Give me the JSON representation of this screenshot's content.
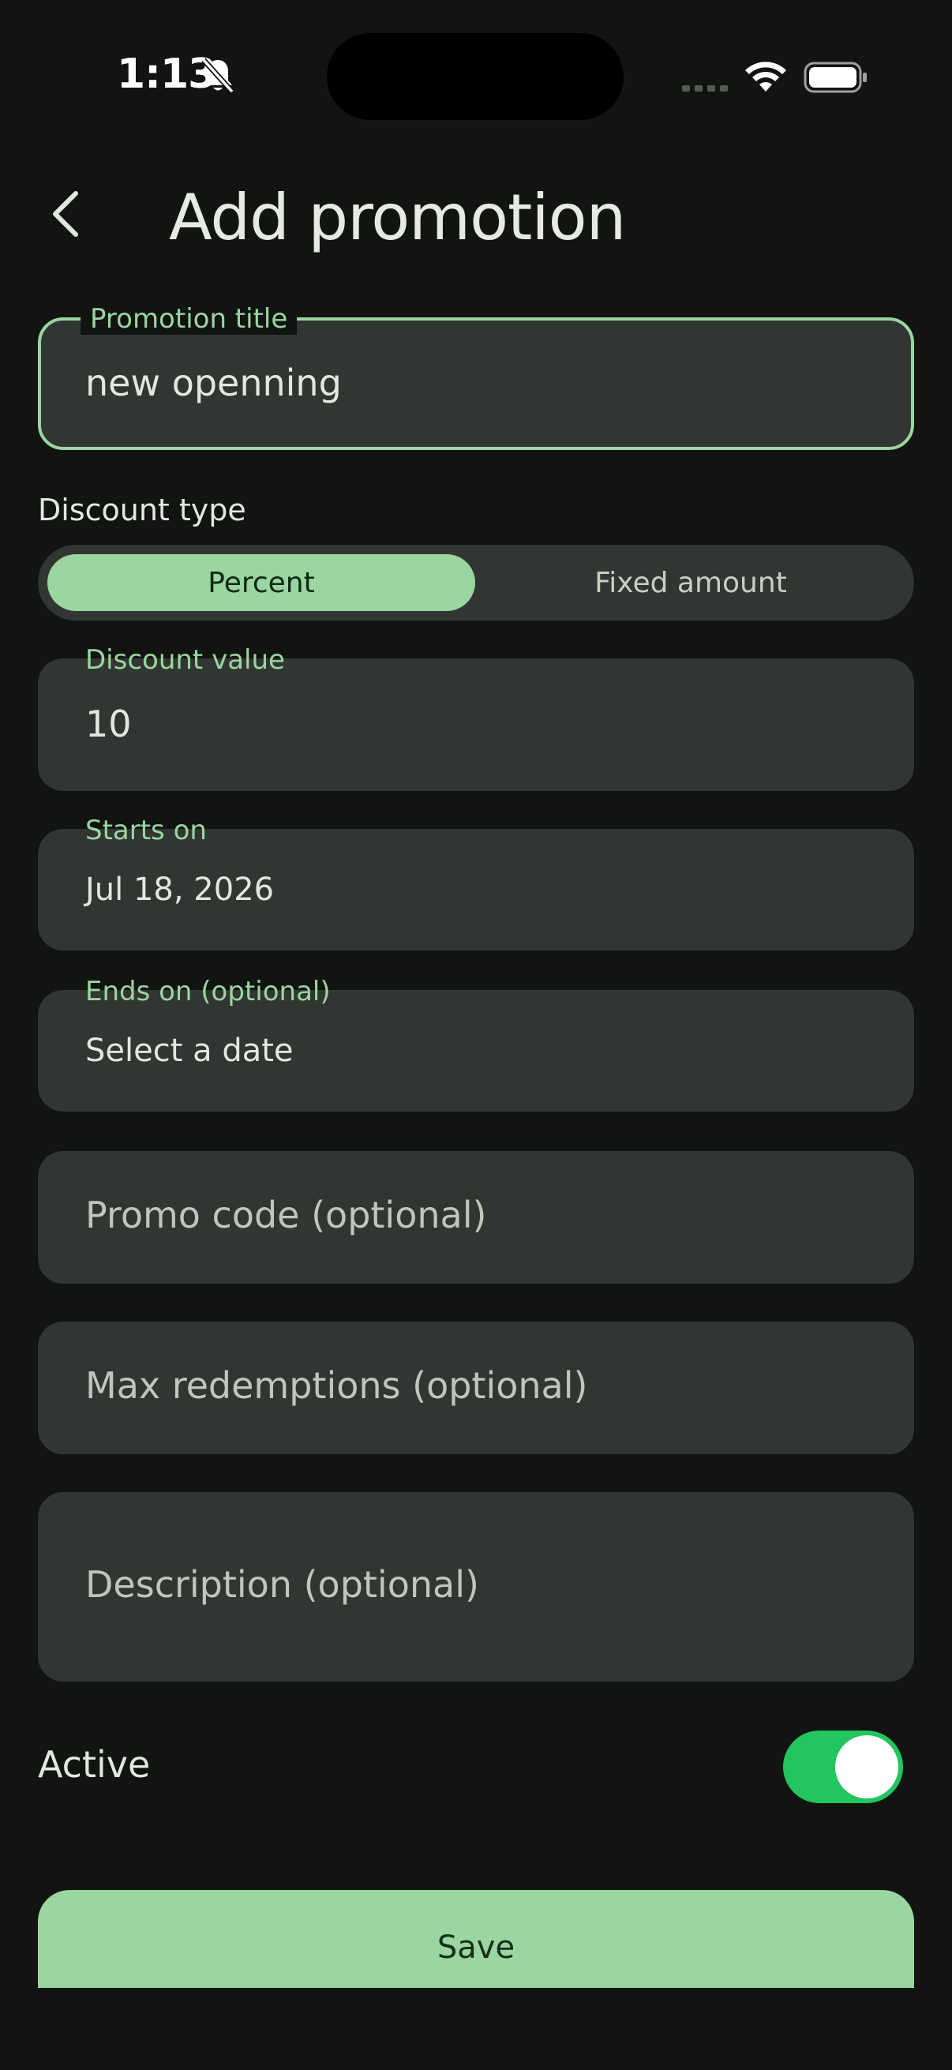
{
  "status_bar": {
    "time": "1:13"
  },
  "header": {
    "title": "Add promotion"
  },
  "form": {
    "promotion_title": {
      "label": "Promotion title",
      "value": "new openning"
    },
    "discount_type": {
      "label": "Discount type",
      "options": [
        "Percent",
        "Fixed amount"
      ],
      "selected": "Percent"
    },
    "discount_value": {
      "label": "Discount value",
      "value": "10"
    },
    "starts_on": {
      "label": "Starts on",
      "value": "Jul 18, 2026"
    },
    "ends_on": {
      "label": "Ends on (optional)",
      "value": "Select a date"
    },
    "promo_code": {
      "placeholder": "Promo code (optional)"
    },
    "max_redemptions": {
      "placeholder": "Max redemptions (optional)"
    },
    "description": {
      "placeholder": "Description (optional)"
    },
    "active": {
      "label": "Active",
      "on": true
    },
    "save_label": "Save"
  },
  "colors": {
    "background": "#111411",
    "field": "#323632",
    "accent": "#9bd5a1",
    "toggle_on": "#22c55e"
  }
}
